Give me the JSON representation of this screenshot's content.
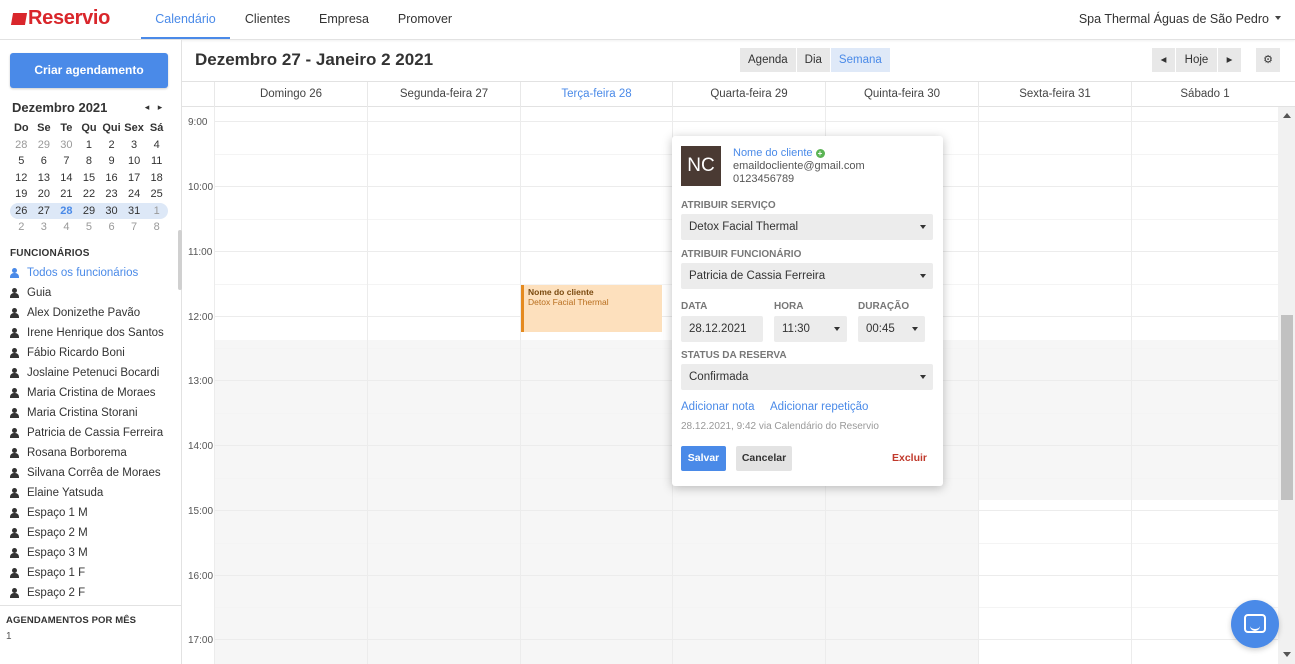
{
  "brand": {
    "name": "Reservio"
  },
  "nav": {
    "tabs": [
      "Calendário",
      "Clientes",
      "Empresa",
      "Promover"
    ],
    "active_tab": "Calendário",
    "org_name": "Spa Thermal Águas de São Pedro"
  },
  "sidebar": {
    "create_button": "Criar agendamento",
    "mini_calendar": {
      "title": "Dezembro 2021",
      "prev": "◂",
      "next": "▸",
      "weekdays": [
        "Do",
        "Se",
        "Te",
        "Qu",
        "Qui",
        "Sex",
        "Sá"
      ],
      "weeks": [
        [
          "28",
          "29",
          "30",
          "1",
          "2",
          "3",
          "4"
        ],
        [
          "5",
          "6",
          "7",
          "8",
          "9",
          "10",
          "11"
        ],
        [
          "12",
          "13",
          "14",
          "15",
          "16",
          "17",
          "18"
        ],
        [
          "19",
          "20",
          "21",
          "22",
          "23",
          "24",
          "25"
        ],
        [
          "26",
          "27",
          "28",
          "29",
          "30",
          "31",
          "1"
        ],
        [
          "2",
          "3",
          "4",
          "5",
          "6",
          "7",
          "8"
        ]
      ]
    },
    "staff_title": "FUNCIONÁRIOS",
    "staff": [
      "Todos os funcionários",
      "Guia",
      "Alex Donizethe Pavão",
      "Irene Henrique dos Santos",
      "Fábio Ricardo Boni",
      "Joslaine Petenuci Bocardi",
      "Maria Cristina de Moraes",
      "Maria Cristina Storani",
      "Patricia de Cassia Ferreira",
      "Rosana Borborema",
      "Silvana Corrêa de Moraes",
      "Elaine Yatsuda",
      "Espaço 1 M",
      "Espaço 2 M",
      "Espaço 3 M",
      "Espaço 1 F",
      "Espaço 2 F"
    ],
    "stats_title": "AGENDAMENTOS POR MÊS",
    "stats_value": "1"
  },
  "header": {
    "range_title": "Dezembro 27 - Janeiro 2 2021",
    "views": [
      "Agenda",
      "Dia",
      "Semana"
    ],
    "active_view": "Semana",
    "prev": "◂",
    "today": "Hoje",
    "next": "▸",
    "settings_icon": "⚙"
  },
  "calendar": {
    "days": [
      "Domingo 26",
      "Segunda-feira 27",
      "Terça-feira 28",
      "Quarta-feira 29",
      "Quinta-feira 30",
      "Sexta-feira 31",
      "Sábado 1"
    ],
    "today_label": "Terça-feira 28",
    "hours": [
      "9:00",
      "10:00",
      "11:00",
      "12:00",
      "13:00",
      "14:00",
      "15:00",
      "16:00",
      "17:00"
    ],
    "event": {
      "client": "Nome do cliente",
      "service": "Detox Facial Thermal"
    }
  },
  "popup": {
    "initials": "NC",
    "client_name": "Nome do cliente",
    "email": "emaildocliente@gmail.com",
    "phone": "0123456789",
    "service_label": "ATRIBUIR SERVIÇO",
    "service_value": "Detox Facial Thermal",
    "staff_label": "ATRIBUIR FUNCIONÁRIO",
    "staff_value": "Patricia de Cassia Ferreira",
    "date_label": "DATA",
    "date_value": "28.12.2021",
    "time_label": "HORA",
    "time_value": "11:30",
    "duration_label": "DURAÇÃO",
    "duration_value": "00:45",
    "status_label": "STATUS DA RESERVA",
    "status_value": "Confirmada",
    "add_note": "Adicionar nota",
    "add_repeat": "Adicionar repetição",
    "meta": "28.12.2021, 9:42 via Calendário do Reservio",
    "save": "Salvar",
    "cancel": "Cancelar",
    "delete": "Excluir"
  },
  "colors": {
    "accent": "#4a8ae8",
    "brand": "#d9262b",
    "event_bg": "#fde0bd",
    "event_border": "#e58a1f",
    "danger": "#c0392b",
    "avatar_bg": "#4a3a33"
  }
}
